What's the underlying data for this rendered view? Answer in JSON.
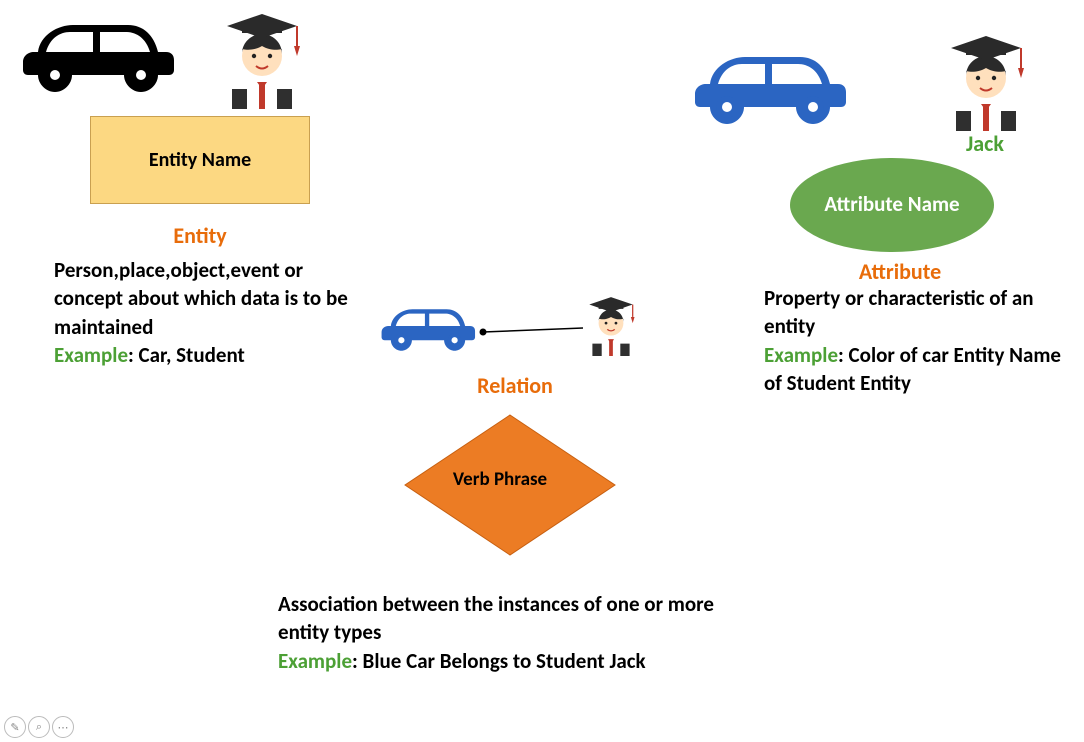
{
  "entity": {
    "box_label": "Entity Name",
    "title": "Entity",
    "desc": "Person,place,object,event or concept about which data is to be maintained",
    "example_label": "Example",
    "example_value": ": Car, Student"
  },
  "attribute": {
    "person_name": "Jack",
    "oval_label": "Attribute Name",
    "title": "Attribute",
    "desc": "Property or characteristic of an entity",
    "example_label": "Example",
    "example_value": ": Color of car Entity Name of Student Entity"
  },
  "relation": {
    "title": "Relation",
    "diamond_label": "Verb Phrase",
    "desc": "Association between the instances of one or more entity types",
    "example_label": "Example",
    "example_value": ": Blue Car Belongs to Student Jack"
  }
}
